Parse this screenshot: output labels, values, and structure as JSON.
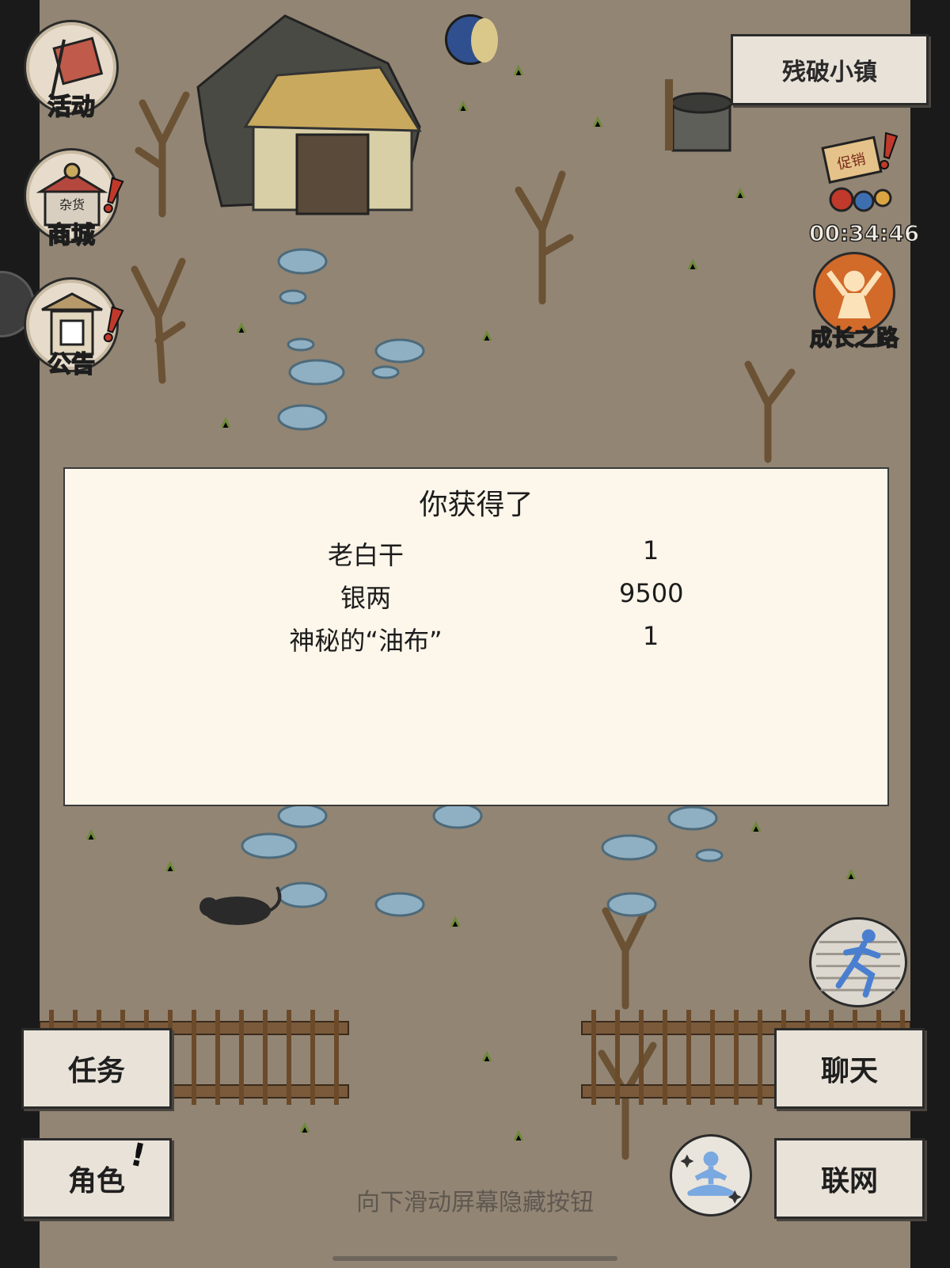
{
  "map": {
    "location_name": "残破小镇"
  },
  "left_menu": [
    {
      "label": "活动",
      "icon": "flag-scroll-icon",
      "alert": false
    },
    {
      "label": "商城",
      "icon": "shop-stall-icon",
      "alert": true,
      "stall_sign": "杂货"
    },
    {
      "label": "公告",
      "icon": "notice-board-icon",
      "alert": true
    }
  ],
  "top_center": {
    "icon": "night-moon-icon"
  },
  "promo": {
    "sign": "促销",
    "timer": "00:34:46",
    "alert": true
  },
  "growth": {
    "label": "成长之路",
    "icon": "growth-figure-icon"
  },
  "reward_dialog": {
    "title": "你获得了",
    "items": [
      {
        "name": "老白干",
        "qty": "1"
      },
      {
        "name": "银两",
        "qty": "9500"
      },
      {
        "name": "神秘的“油布”",
        "qty": "1"
      }
    ]
  },
  "bottom_buttons": {
    "tasks": "任务",
    "character": "角色",
    "character_alert": "!",
    "chat": "聊天",
    "network": "联网"
  },
  "run_icon": "running-figure-icon",
  "meditate_icon": "meditation-figure-icon",
  "hint": "向下滑动屏幕隐藏按钮",
  "colors": {
    "ground": "#928574",
    "dialog": "#fdf6ea",
    "stone": "#8fb0c3",
    "alert": "#c0392b"
  }
}
